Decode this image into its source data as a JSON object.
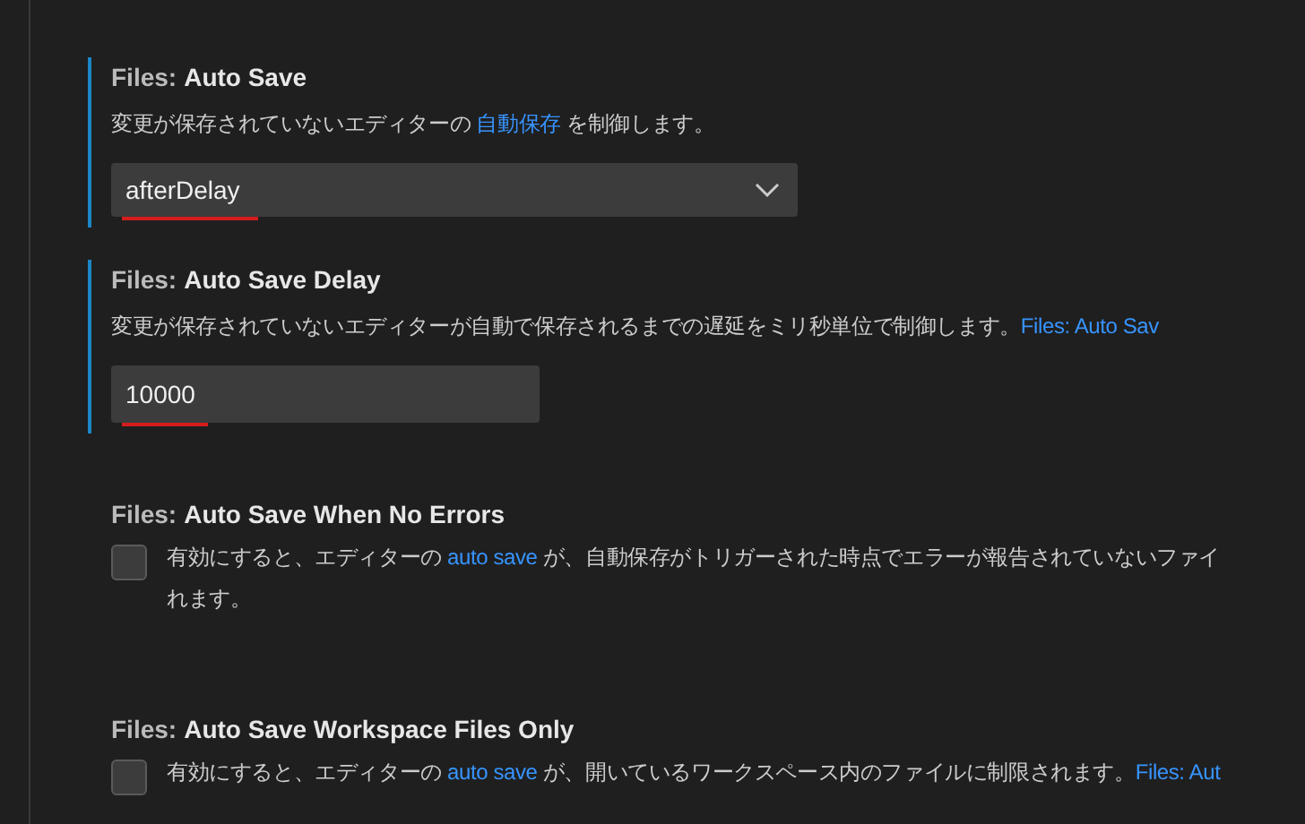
{
  "settings": [
    {
      "kind": "dropdown",
      "modified": true,
      "category": "Files:",
      "title": "Auto Save",
      "description": [
        [
          {
            "text": "変更が保存されていないエディターの ",
            "link": false
          },
          {
            "text": "自動保存",
            "link": true
          },
          {
            "text": " を制御します。",
            "link": false
          }
        ]
      ],
      "value": "afterDelay",
      "underlined": true
    },
    {
      "kind": "number",
      "modified": true,
      "category": "Files:",
      "title": "Auto Save Delay",
      "description": [
        [
          {
            "text": "変更が保存されていないエディターが自動で保存されるまでの遅延をミリ秒単位で制御します。",
            "link": false
          },
          {
            "text": "Files: Auto Sav",
            "link": true
          }
        ]
      ],
      "value": "10000",
      "underlined": true
    },
    {
      "kind": "checkbox",
      "modified": false,
      "category": "Files:",
      "title": "Auto Save When No Errors",
      "description": [
        [
          {
            "text": "有効にすると、エディターの ",
            "link": false
          },
          {
            "text": "auto save",
            "link": true
          },
          {
            "text": " が、自動保存がトリガーされた時点でエラーが報告されていないファイ",
            "link": false
          }
        ],
        [
          {
            "text": "れます。",
            "link": false
          }
        ]
      ],
      "checked": false
    },
    {
      "kind": "checkbox",
      "modified": false,
      "category": "Files:",
      "title": "Auto Save Workspace Files Only",
      "description": [
        [
          {
            "text": "有効にすると、エディターの ",
            "link": false
          },
          {
            "text": "auto save",
            "link": true
          },
          {
            "text": " が、開いているワークスペース内のファイルに制限されます。",
            "link": false
          },
          {
            "text": "Files: Aut",
            "link": true
          }
        ]
      ],
      "checked": false
    }
  ]
}
